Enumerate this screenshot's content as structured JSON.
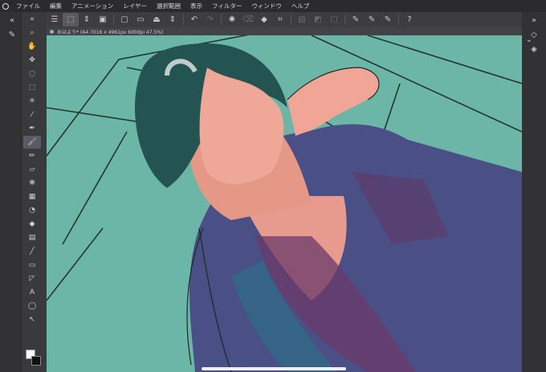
{
  "menu": {
    "items": [
      "ファイル",
      "編集",
      "アニメーション",
      "レイヤー",
      "選択範囲",
      "表示",
      "フィルター",
      "ウィンドウ",
      "ヘルプ"
    ]
  },
  "toolbar": {
    "icons": [
      "menu-icon",
      "layer-move-icon",
      "chevron-updown-icon",
      "transparency-icon",
      "new-icon",
      "open-icon",
      "save-icon",
      "chevron-updown-icon",
      "undo-icon",
      "redo-icon",
      "rotate-icon",
      "clear-icon",
      "fill-icon",
      "crop-icon",
      "transform-icon",
      "color-icon",
      "deselect-icon",
      "pen-icon",
      "brush-icon",
      "eraser-icon",
      "help-icon"
    ]
  },
  "document": {
    "tab_title": "おはよう* (A4 7016 x 4961px 600dpi 47.5%)"
  },
  "tools": [
    "search-icon",
    "hand-icon",
    "move-icon",
    "lasso-icon",
    "select-icon",
    "eyedropper-icon",
    "pen-icon",
    "pencil-icon",
    "brush-icon",
    "eraser-icon",
    "decoration-icon",
    "airbrush-icon",
    "blend-icon",
    "fill-icon",
    "gradient-icon",
    "line-icon",
    "frame-icon",
    "ruler-icon",
    "text-icon",
    "balloon-icon",
    "correct-icon"
  ],
  "sub_tools": [
    "brush-variant-icon",
    "brush-variant-icon",
    "brush-variant-icon"
  ],
  "colors": {
    "accent": "#6cb6a7",
    "main_color": "#ffffff",
    "sub_color": "#111111"
  }
}
